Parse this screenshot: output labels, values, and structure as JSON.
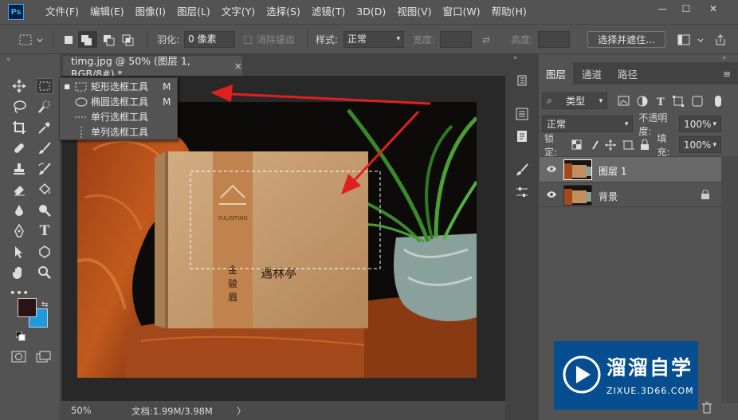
{
  "app": {
    "logo_text": "Ps"
  },
  "menu": [
    "文件(F)",
    "编辑(E)",
    "图像(I)",
    "图层(L)",
    "文字(Y)",
    "选择(S)",
    "滤镜(T)",
    "3D(D)",
    "视图(V)",
    "窗口(W)",
    "帮助(H)"
  ],
  "window_controls": {
    "minimize": "—",
    "maximize": "☐",
    "close": "✕"
  },
  "options": {
    "feather_label": "羽化:",
    "feather_value": "0 像素",
    "antialias_label": "消除锯齿",
    "style_label": "样式:",
    "style_value": "正常",
    "width_label": "宽度:",
    "height_label": "高度:",
    "select_mask_button": "选择并遮住..."
  },
  "document": {
    "tab_title": "timg.jpg @ 50% (图层 1, RGB/8#) *",
    "close_glyph": "×",
    "zoom": "50%",
    "doc_info": "文档:1.99M/3.98M",
    "status_arrow": "〉"
  },
  "flyout": {
    "items": [
      {
        "label": "矩形选框工具",
        "shortcut": "M",
        "selected": true
      },
      {
        "label": "椭圆选框工具",
        "shortcut": "M",
        "selected": false
      },
      {
        "label": "单行选框工具",
        "shortcut": "",
        "selected": false
      },
      {
        "label": "单列选框工具",
        "shortcut": "",
        "selected": false
      }
    ]
  },
  "photo": {
    "box_brand": "YULINTING",
    "box_vertical_text": "金\n骏\n眉",
    "box_logo_text": "遇林亭"
  },
  "layers_panel": {
    "tabs": [
      "图层",
      "通道",
      "路径"
    ],
    "filter_kind": "类型",
    "blend_mode": "正常",
    "opacity_label": "不透明度:",
    "opacity_value": "100%",
    "lock_label": "锁定:",
    "fill_label": "填充:",
    "fill_value": "100%",
    "layers": [
      {
        "name": "图层 1",
        "visible": true,
        "selected": true,
        "locked": false
      },
      {
        "name": "背景",
        "visible": true,
        "selected": false,
        "locked": true
      }
    ]
  },
  "watermark": {
    "text": "溜溜自学",
    "url": "ZIXUE.3D66.COM"
  },
  "colors": {
    "foreground": "#2a1215",
    "background": "#1f9ae0",
    "annotation_arrow": "#e02020",
    "panel_bg": "#535353",
    "selected_layer": "#696969"
  }
}
